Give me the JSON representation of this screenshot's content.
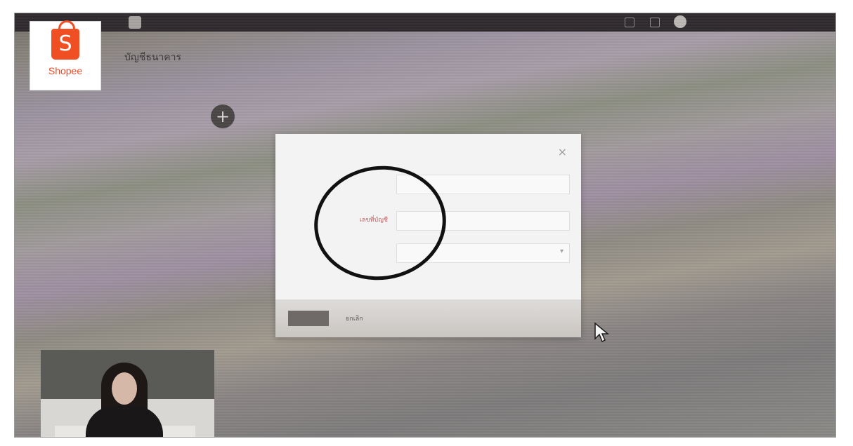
{
  "topbar": {
    "tab_text": "",
    "section_text": ""
  },
  "logo": {
    "glyph": "S",
    "word": "Shopee"
  },
  "page": {
    "heading": "บัญชีธนาคาร",
    "add_icon": "plus-icon",
    "add_label": ""
  },
  "dialog": {
    "title": "",
    "close_glyph": "×",
    "fields": [
      {
        "label": "",
        "value": ""
      },
      {
        "label": "เลขที่บัญชี",
        "value": ""
      },
      {
        "label": "",
        "value": ""
      }
    ],
    "note": "",
    "save_label": "",
    "cancel_label": "ยกเลิก",
    "link_label": ""
  },
  "footer_link": "",
  "colors": {
    "shopee_orange": "#f04e23",
    "annotation_ring": "#111111"
  }
}
